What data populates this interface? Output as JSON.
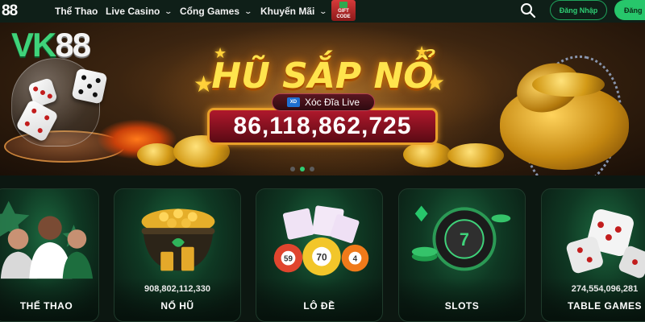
{
  "nav": {
    "logo": "88",
    "links": [
      {
        "label": "Thể Thao",
        "has_dropdown": false
      },
      {
        "label": "Live Casino",
        "has_dropdown": true
      },
      {
        "label": "Cổng Games",
        "has_dropdown": true
      },
      {
        "label": "Khuyến Mãi",
        "has_dropdown": true
      }
    ],
    "gift_code": {
      "line1": "GIFT",
      "line2": "CODE"
    },
    "search_icon": "search-icon",
    "login_label": "Đăng Nhập",
    "register_label": "Đăng"
  },
  "banner": {
    "brand_green": "VK",
    "brand_white": "88",
    "jackpot_title": "HŨ SẮP NỔ",
    "game_name": "Xóc Đĩa Live",
    "game_badge": "XD",
    "jackpot_amount": "86,118,862,725",
    "slides": 3,
    "active_slide": 2
  },
  "categories": [
    {
      "label": "THỂ THAO",
      "value": ""
    },
    {
      "label": "NỔ HŨ",
      "value": "908,802,112,330"
    },
    {
      "label": "LÔ ĐỀ",
      "value": ""
    },
    {
      "label": "SLOTS",
      "value": ""
    },
    {
      "label": "TABLE GAMES",
      "value": "274,554,096,281"
    }
  ],
  "colors": {
    "accent": "#27c66b",
    "nav_bg": "#0f1f18",
    "jackpot_text": "#ffe44d",
    "counter_bg": "#b0182c"
  }
}
